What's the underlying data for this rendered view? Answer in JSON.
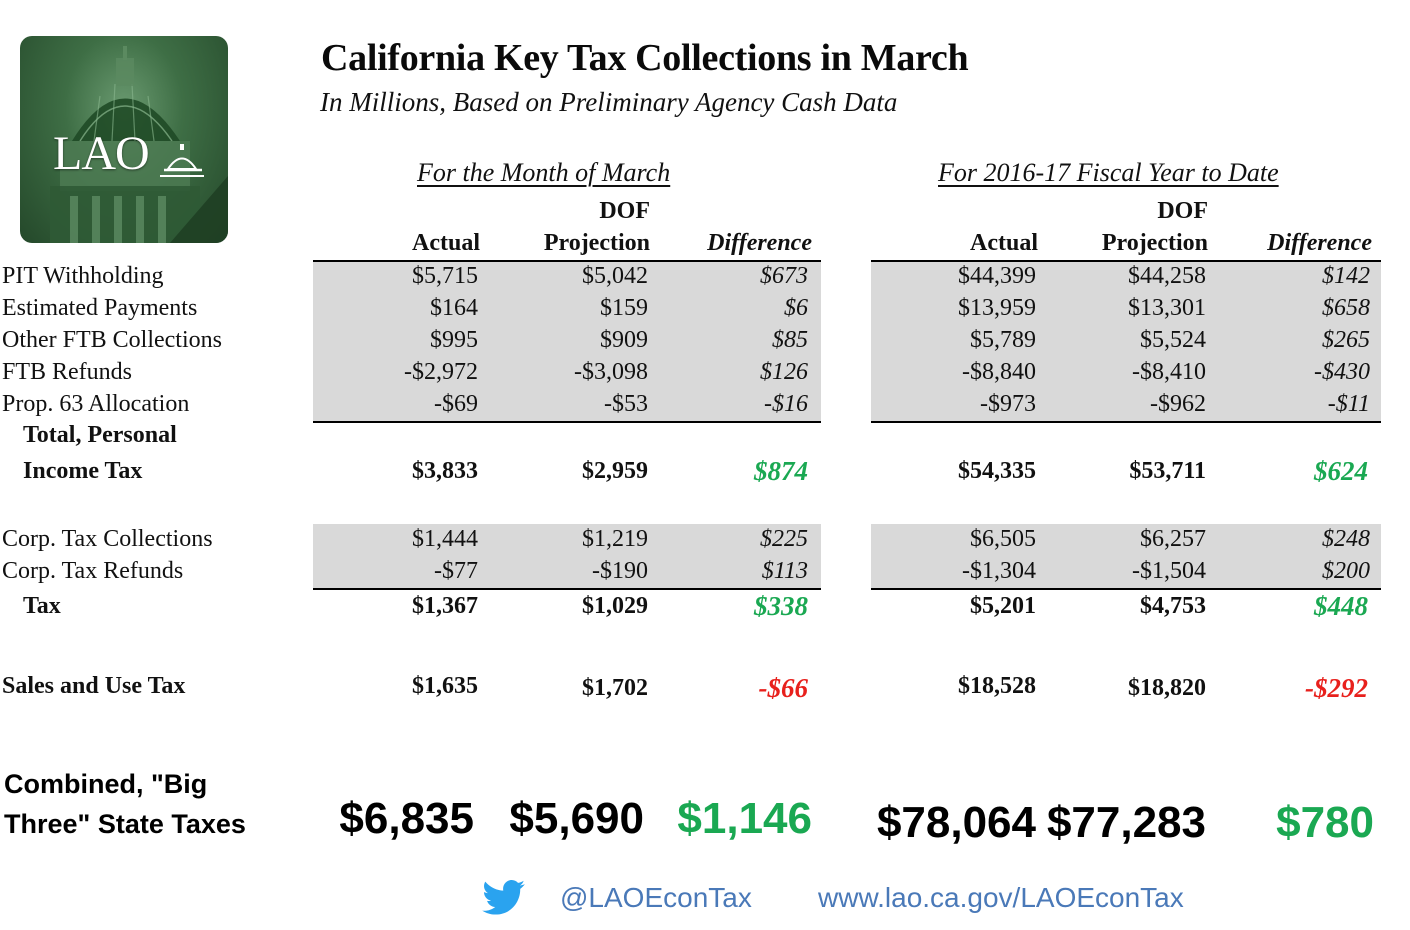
{
  "logo": {
    "text": "LAO",
    "icon": "capitol-dome-icon"
  },
  "title": "California Key Tax Collections in March",
  "subtitle": "In Millions, Based on Preliminary Agency Cash Data",
  "sections": {
    "month": "For the Month of March",
    "fiscal": "For 2016-17 Fiscal Year to Date"
  },
  "columns": {
    "actual": "Actual",
    "dof": "DOF",
    "projection": "Projection",
    "difference": "Difference"
  },
  "pit_rows": [
    {
      "label": "PIT Withholding",
      "m_actual": "$5,715",
      "m_proj": "$5,042",
      "m_diff": "$673",
      "f_actual": "$44,399",
      "f_proj": "$44,258",
      "f_diff": "$142"
    },
    {
      "label": "Estimated Payments",
      "m_actual": "$164",
      "m_proj": "$159",
      "m_diff": "$6",
      "f_actual": "$13,959",
      "f_proj": "$13,301",
      "f_diff": "$658"
    },
    {
      "label": "Other FTB Collections",
      "m_actual": "$995",
      "m_proj": "$909",
      "m_diff": "$85",
      "f_actual": "$5,789",
      "f_proj": "$5,524",
      "f_diff": "$265"
    },
    {
      "label": "FTB Refunds",
      "m_actual": "-$2,972",
      "m_proj": "-$3,098",
      "m_diff": "$126",
      "f_actual": "-$8,840",
      "f_proj": "-$8,410",
      "f_diff": "-$430"
    },
    {
      "label": "Prop. 63 Allocation",
      "m_actual": "-$69",
      "m_proj": "-$53",
      "m_diff": "-$16",
      "f_actual": "-$973",
      "f_proj": "-$962",
      "f_diff": "-$11"
    }
  ],
  "pit_total": {
    "label_line1": "Total, Personal",
    "label_line2": "Income Tax",
    "m_actual": "$3,833",
    "m_proj": "$2,959",
    "m_diff": "$874",
    "f_actual": "$54,335",
    "f_proj": "$53,711",
    "f_diff": "$624"
  },
  "corp_rows": [
    {
      "label": "Corp. Tax Collections",
      "m_actual": "$1,444",
      "m_proj": "$1,219",
      "m_diff": "$225",
      "f_actual": "$6,505",
      "f_proj": "$6,257",
      "f_diff": "$248"
    },
    {
      "label": "Corp. Tax Refunds",
      "m_actual": "-$77",
      "m_proj": "-$190",
      "m_diff": "$113",
      "f_actual": "-$1,304",
      "f_proj": "-$1,504",
      "f_diff": "$200"
    }
  ],
  "corp_total": {
    "label": "Tax",
    "m_actual": "$1,367",
    "m_proj": "$1,029",
    "m_diff": "$338",
    "f_actual": "$5,201",
    "f_proj": "$4,753",
    "f_diff": "$448"
  },
  "sales": {
    "label": "Sales and Use Tax",
    "m_actual": "$1,635",
    "m_proj": "$1,702",
    "m_diff": "-$66",
    "f_actual": "$18,528",
    "f_proj": "$18,820",
    "f_diff": "-$292"
  },
  "combined": {
    "label_line1": "Combined, \"Big",
    "label_line2": "Three\" State Taxes",
    "m_actual": "$6,835",
    "m_proj": "$5,690",
    "m_diff": "$1,146",
    "f_actual": "$78,064",
    "f_proj": "$77,283",
    "f_diff": "$780"
  },
  "footer": {
    "twitter_icon": "twitter-bird-icon",
    "handle": "@LAOEconTax",
    "url": "www.lao.ca.gov/LAOEconTax"
  },
  "colors": {
    "positive": "#1aa852",
    "negative": "#e8201c",
    "link": "#4a79b8",
    "twitter": "#2aa3ef",
    "band": "#d9d9d9"
  }
}
